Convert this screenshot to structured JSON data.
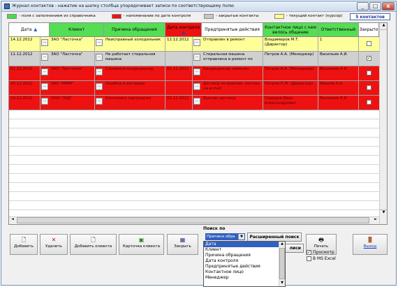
{
  "window": {
    "title": "Журнал контактов - нажатие на шапку столбца упорядочивает записи по соответствующему полю",
    "min": "_",
    "max": "□",
    "close": "x"
  },
  "legend": [
    {
      "color": "#44dd44",
      "label": "- поля с заполнением из справочника"
    },
    {
      "color": "#ee1111",
      "label": "- напоминание по дате контроля"
    },
    {
      "color": "#c8c8c8",
      "label": "- закрытые контакты"
    },
    {
      "color": "#ffff88",
      "label": "- текущий контакт (курсор)"
    }
  ],
  "count_label": "5 контактов",
  "columns": [
    "Дата",
    "Клиент",
    "Причина обращения",
    "Дата контроля",
    "Предпринятые действия",
    "Контактное лицо с кем велось общение",
    "Ответственный",
    "Закрыто"
  ],
  "sort_arrow": "▲",
  "ellipsis": "...",
  "rows": [
    {
      "date": "14.12.2012",
      "client": "ЗАО \"Ласточка\"",
      "reason": "Неисправный холодильник",
      "ctrl_date": "12.12.2012",
      "action": "Отправлен в ремонт",
      "contact": "Владимиров М.Т. (Директор)",
      "resp": "1",
      "closed": "",
      "bg": "#ffff99"
    },
    {
      "date": "11.12.2012",
      "client": "ЗАО \"Ласточка\"",
      "reason": "Не работает стиральная машина",
      "ctrl_date": "",
      "action": "Стиральная машина отправлена в ремонт по",
      "contact": "Петров А.А. (Менеджер)",
      "resp": "Васильев А.И.",
      "closed": "✓",
      "bg": "#d0d0d0"
    },
    {
      "date": "01.12.2012",
      "client": "ЗАО \"Ласточка\"",
      "reason": "Сломался кондиционер",
      "ctrl_date": "01.12.2012",
      "action": "Кондиционер заменен",
      "contact": "Петров А.А. (Менеджер)",
      "resp": "Васильев А.И.",
      "closed": "",
      "bg": "#ee1111"
    },
    {
      "date": "15.11.2012",
      "client": "ЗАО \"МММ\"",
      "reason": "Ошибка в договоре",
      "ctrl_date": "",
      "action": "Договор исправлен, выслан на e-mail",
      "contact": "Петров П.М. (Директор)",
      "resp": "Иванов А.А.",
      "closed": "",
      "bg": "#ee1111"
    },
    {
      "date": "10.11.2012",
      "client": "ООО \"ЮД\"",
      "reason": "Кончилась картриджи",
      "ctrl_date": "01.12.2012",
      "action": "Выслан договор",
      "contact": "Сидоров Иван Александрович",
      "resp": "Васильев А.И.",
      "closed": "",
      "bg": "#ee1111"
    }
  ],
  "toolbar": {
    "add": "Добавить",
    "delete": "Удалить",
    "add_client": "Добавить клиента",
    "client_card": "Карточка клиента",
    "close": "Закрыть",
    "print": "Печать",
    "exit": "Выход"
  },
  "search": {
    "label": "Поиск по",
    "selected": "Причина обра",
    "advanced": "Расширенный поиск",
    "search_hidden": "лиси",
    "options": [
      "Дата",
      "Клиент",
      "Причина обращения",
      "Дата контроля",
      "Предпринятые действия",
      "Контактное лицо",
      "Менеджер"
    ]
  },
  "checkboxes": {
    "preview": "Просмотр",
    "excel": "В MS Excel",
    "preview_checked": "✓"
  }
}
